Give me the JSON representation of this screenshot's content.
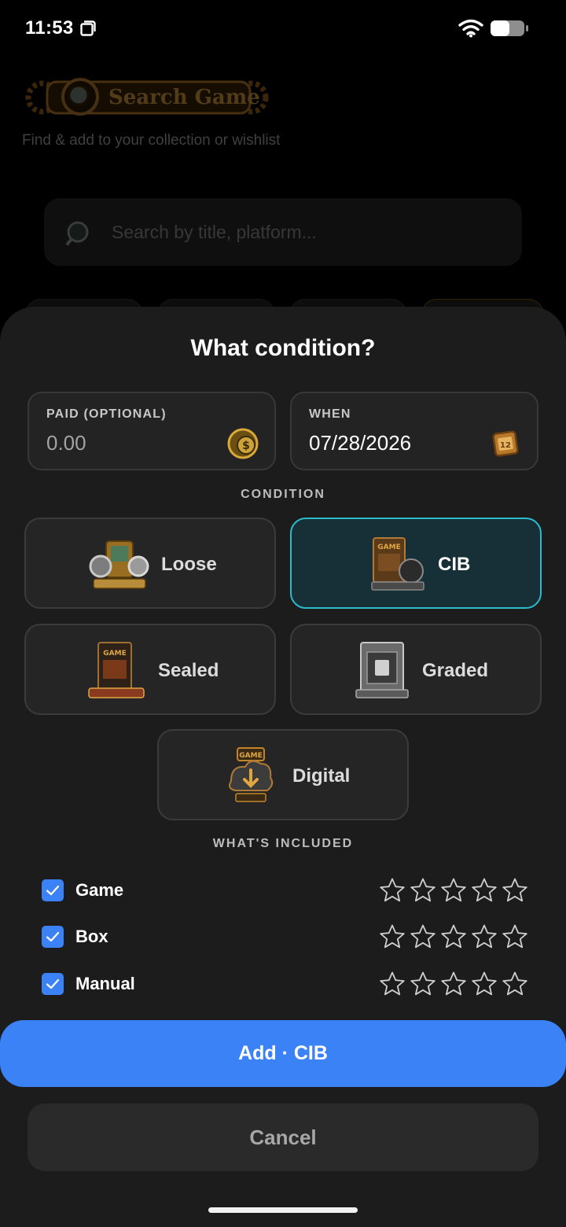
{
  "status_bar": {
    "time": "11:53"
  },
  "background": {
    "logo_text": "Search Game",
    "subtitle": "Find & add to your collection or wishlist",
    "search_placeholder": "Search by title, platform..."
  },
  "sheet": {
    "title": "What condition?",
    "paid_field": {
      "label": "PAID (OPTIONAL)",
      "value": "0.00",
      "icon": "currency-coin-icon"
    },
    "when_field": {
      "label": "WHEN",
      "value": "07/28/2026",
      "icon": "calendar-icon"
    },
    "condition_label": "CONDITION",
    "conditions": [
      {
        "label": "Loose",
        "icon": "loose-cart-icon",
        "selected": false
      },
      {
        "label": "CIB",
        "icon": "cib-box-icon",
        "selected": true
      },
      {
        "label": "Sealed",
        "icon": "sealed-box-icon",
        "selected": false
      },
      {
        "label": "Graded",
        "icon": "graded-slab-icon",
        "selected": false
      },
      {
        "label": "Digital",
        "icon": "digital-download-icon",
        "selected": false
      }
    ],
    "included_label": "WHAT'S INCLUDED",
    "included": [
      {
        "label": "Game",
        "checked": true,
        "rating": 0,
        "max_rating": 5
      },
      {
        "label": "Box",
        "checked": true,
        "rating": 0,
        "max_rating": 5
      },
      {
        "label": "Manual",
        "checked": true,
        "rating": 0,
        "max_rating": 5
      }
    ],
    "add_button": "Add · CIB",
    "cancel_button": "Cancel"
  },
  "colors": {
    "accent_blue": "#3b82f6",
    "selected_border": "#2bbccc",
    "selected_bg": "#173038",
    "sheet_bg": "#1c1c1d"
  }
}
